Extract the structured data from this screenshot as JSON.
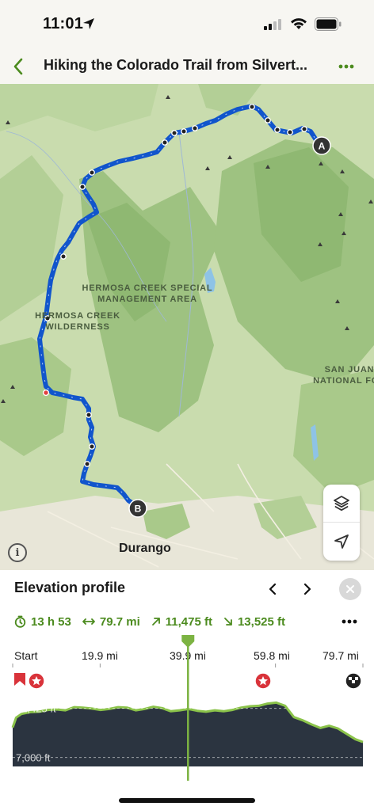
{
  "status_bar": {
    "time": "11:01",
    "icons": [
      "location-arrow-icon",
      "cellular-signal-icon",
      "wifi-icon",
      "battery-icon"
    ]
  },
  "nav": {
    "title": "Hiking the Colorado Trail from Silvert...",
    "back_icon": "chevron-left-icon",
    "more_icon": "more-dots-icon"
  },
  "map": {
    "labels": {
      "hermosa_sma": [
        "HERMOSA CREEK SPECIAL",
        "MANAGEMENT AREA"
      ],
      "hermosa_wild": [
        "HERMOSA CREEK",
        "WILDERNESS"
      ],
      "san_juan": [
        "SAN JUAN",
        "NATIONAL FOR"
      ],
      "durango": "Durango"
    },
    "markers": {
      "start": "A",
      "end": "B"
    },
    "controls": [
      "layers-icon",
      "locate-arrow-icon",
      "info-icon"
    ],
    "info_symbol": "i",
    "colors": {
      "route": "#1155cc",
      "forest": "#9ec281",
      "land": "#c9dcae",
      "town": "#e8e6d8"
    }
  },
  "elevation": {
    "title": "Elevation profile",
    "stats": {
      "duration": "13 h 53",
      "distance": "79.7 mi",
      "ascent": "11,475 ft",
      "descent": "13,525 ft"
    },
    "stat_icons": [
      "stopwatch-icon",
      "distance-arrows-icon",
      "ascent-arrow-icon",
      "descent-arrow-icon"
    ],
    "accent_color": "#4c8b1f",
    "x_ticks": [
      "Start",
      "19.9 mi",
      "39.9 mi",
      "59.8 mi",
      "79.7 mi"
    ],
    "y_labels": [
      "12,425 ft",
      "7,000 ft"
    ]
  },
  "chart_data": {
    "type": "area",
    "title": "Elevation profile",
    "xlabel": "",
    "ylabel": "",
    "x_unit": "mi",
    "y_unit": "ft",
    "xlim": [
      0,
      79.7
    ],
    "x_ticks": [
      0,
      19.9,
      39.9,
      59.8,
      79.7
    ],
    "y_ticks": [
      12425,
      7000
    ],
    "grid": true,
    "cursor_x": 39.9,
    "x": [
      0,
      0.8,
      2,
      4,
      6,
      8,
      10,
      12,
      14,
      16,
      18,
      20,
      22,
      24,
      26,
      28,
      30,
      32,
      34,
      36,
      38,
      40,
      42,
      44,
      46,
      48,
      50,
      52,
      54,
      56,
      58,
      60,
      62,
      64,
      66,
      68,
      70,
      72,
      74,
      76,
      78,
      79.7
    ],
    "values": [
      10300,
      11400,
      11800,
      12000,
      12050,
      12250,
      12300,
      12200,
      12550,
      12500,
      12400,
      12250,
      12350,
      12550,
      12500,
      12200,
      12350,
      12600,
      12450,
      12100,
      12200,
      12350,
      12150,
      12050,
      12200,
      12100,
      12250,
      12500,
      12650,
      12700,
      12950,
      13050,
      12700,
      11450,
      11100,
      10650,
      10250,
      10500,
      10200,
      9600,
      9000,
      8700
    ]
  }
}
